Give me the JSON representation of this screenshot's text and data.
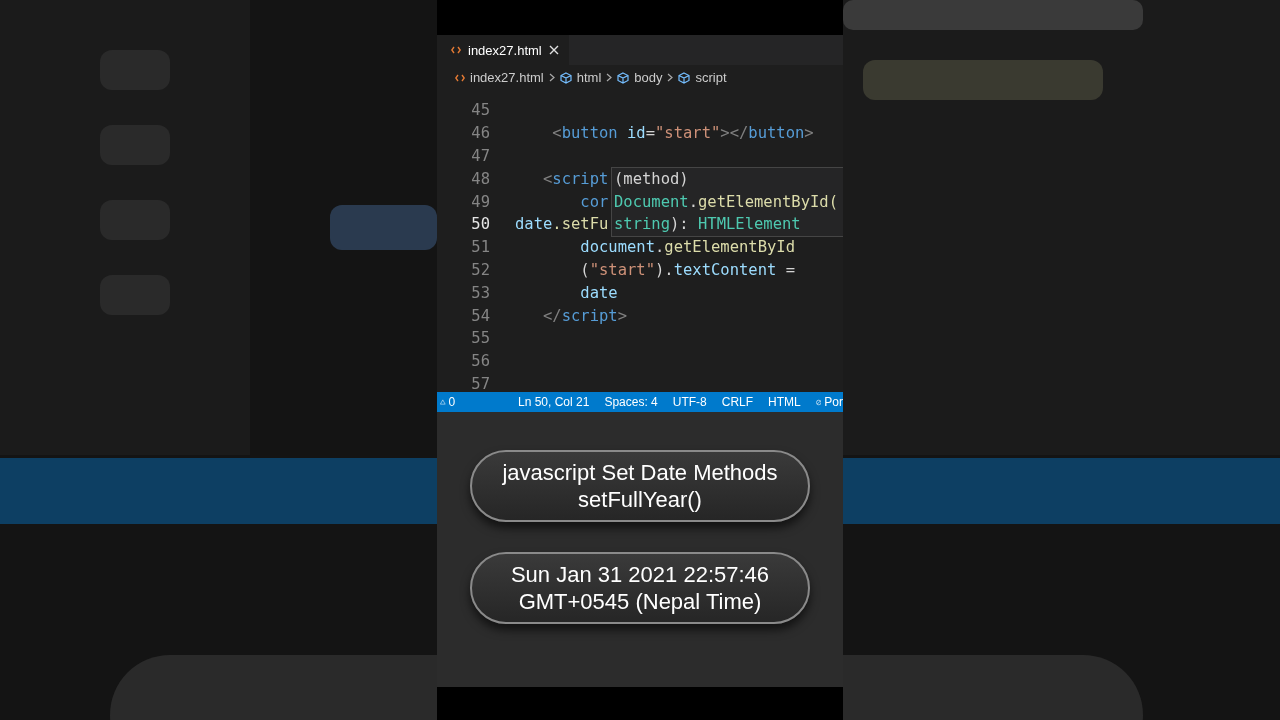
{
  "editor": {
    "tab": {
      "label": "index27.html",
      "selected": true
    },
    "breadcrumb": [
      "index27.html",
      "html",
      "body",
      "script"
    ],
    "lines": [
      {
        "number": "45",
        "current": false
      },
      {
        "number": "46",
        "current": false,
        "segments": [
          {
            "text": "    <",
            "kind": "punct"
          },
          {
            "text": "button",
            "kind": "tag"
          },
          {
            "text": " id",
            "kind": "attr"
          },
          {
            "text": "=",
            "kind": "plain"
          },
          {
            "text": "\"start\"",
            "kind": "string"
          },
          {
            "text": "></",
            "kind": "punct"
          },
          {
            "text": "button",
            "kind": "tag"
          },
          {
            "text": ">",
            "kind": "punct"
          }
        ]
      },
      {
        "number": "47",
        "current": false
      },
      {
        "number": "48",
        "current": false,
        "segments": [
          {
            "text": "   <",
            "kind": "punct"
          },
          {
            "text": "script",
            "kind": "tag"
          }
        ]
      },
      {
        "number": "49",
        "current": false,
        "segments": [
          {
            "text": "       cor",
            "kind": "tag"
          }
        ]
      },
      {
        "number": "50",
        "current": true,
        "segments": [
          {
            "text": "date",
            "kind": "var"
          },
          {
            "text": ".setFu",
            "kind": "fn"
          }
        ]
      },
      {
        "number": "51",
        "current": false,
        "segments": [
          {
            "text": "       document",
            "kind": "var"
          },
          {
            "text": ".",
            "kind": "plain"
          },
          {
            "text": "getElementById",
            "kind": "fn"
          }
        ]
      },
      {
        "number": "52",
        "current": false,
        "segments": [
          {
            "text": "       (",
            "kind": "plain"
          },
          {
            "text": "\"start\"",
            "kind": "string"
          },
          {
            "text": ").",
            "kind": "plain"
          },
          {
            "text": "textContent",
            "kind": "var"
          },
          {
            "text": " =",
            "kind": "plain"
          }
        ]
      },
      {
        "number": "53",
        "current": false,
        "segments": [
          {
            "text": "       date",
            "kind": "var"
          }
        ]
      },
      {
        "number": "54",
        "current": false,
        "segments": [
          {
            "text": "   </",
            "kind": "punct"
          },
          {
            "text": "script",
            "kind": "tag"
          },
          {
            "text": ">",
            "kind": "punct"
          }
        ]
      },
      {
        "number": "55",
        "current": false
      },
      {
        "number": "56",
        "current": false
      },
      {
        "number": "57",
        "current": false
      }
    ],
    "tooltip": [
      [
        {
          "text": "(method)",
          "kind": "plain"
        }
      ],
      [
        {
          "text": "Document",
          "kind": "type"
        },
        {
          "text": ".",
          "kind": "plain"
        },
        {
          "text": "getElementById(",
          "kind": "fn"
        }
      ],
      [
        {
          "text": "string",
          "kind": "type"
        },
        {
          "text": "): ",
          "kind": "plain"
        },
        {
          "text": "HTMLElement",
          "kind": "type"
        }
      ]
    ]
  },
  "status_bar": {
    "problems": "0",
    "items": [
      "Ln 50, Col 21",
      "Spaces: 4",
      "UTF-8",
      "CRLF",
      "HTML"
    ],
    "port": "Por"
  },
  "preview": {
    "buttons": [
      {
        "lines": [
          "javascript Set Date Methods",
          "setFullYear()"
        ]
      },
      {
        "lines": [
          "Sun Jan 31 2021 22:57:46",
          "GMT+0545 (Nepal Time)"
        ]
      }
    ]
  }
}
